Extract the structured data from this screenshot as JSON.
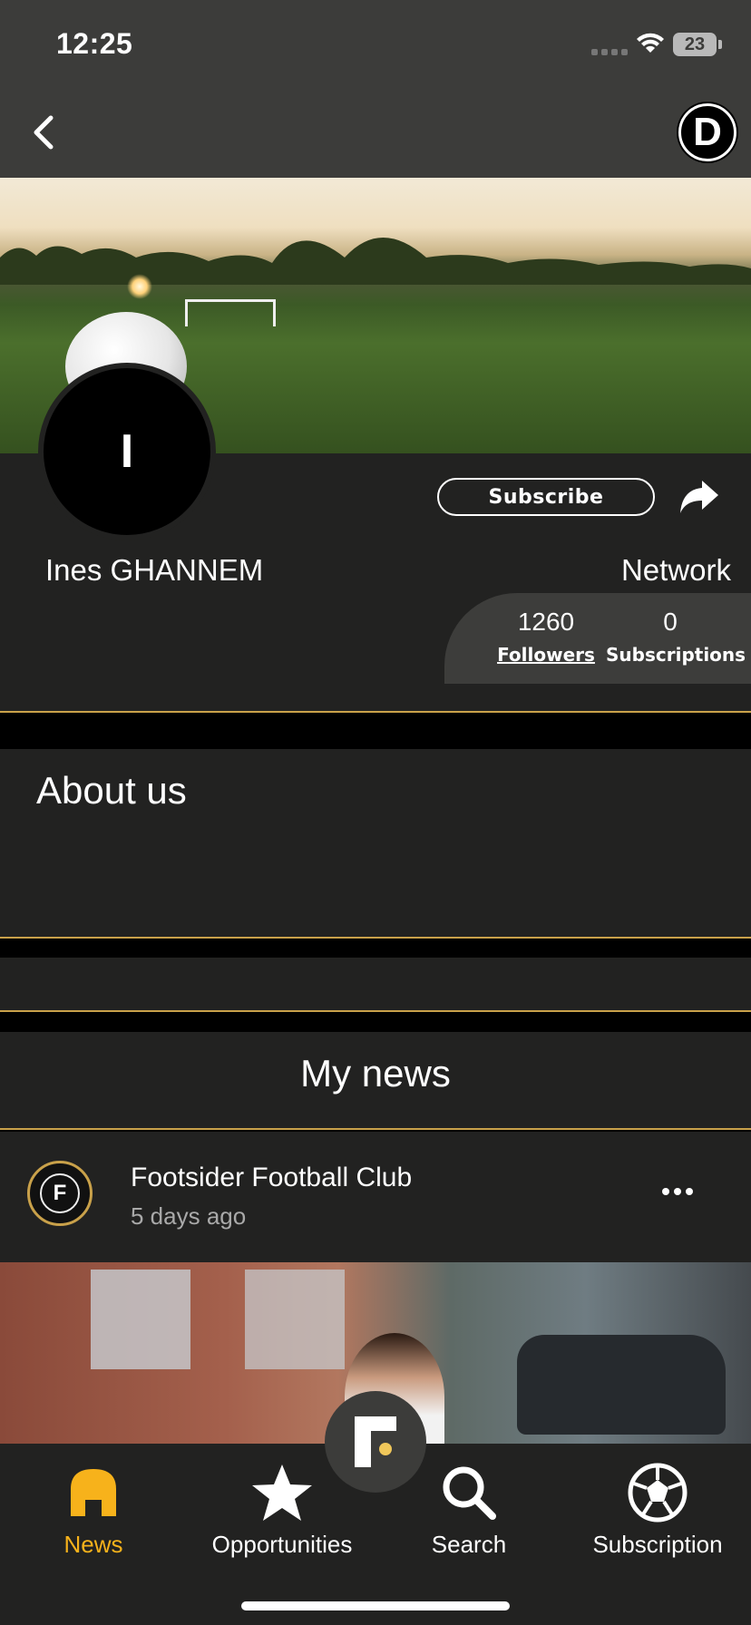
{
  "status_bar": {
    "time": "12:25",
    "battery": "23"
  },
  "header": {
    "logo_letter": "D"
  },
  "profile": {
    "avatar_letter": "I",
    "name": "Ines GHANNEM",
    "subscribe_label": "Subscribe",
    "network_label": "Network",
    "followers_count": "1260",
    "followers_label": "Followers",
    "subscriptions_count": "0",
    "subscriptions_label": "Subscriptions"
  },
  "about": {
    "title": "About us"
  },
  "news": {
    "title": "My news",
    "post": {
      "author": "Footsider Football Club",
      "time": "5 days ago",
      "logo_letter": "F"
    }
  },
  "bottom_nav": [
    {
      "label": "News",
      "icon": "home-icon",
      "active": true
    },
    {
      "label": "Opportunities",
      "icon": "star-icon",
      "active": false
    },
    {
      "label": "Search",
      "icon": "search-icon",
      "active": false
    },
    {
      "label": "Subscription",
      "icon": "soccer-ball-icon",
      "active": false
    }
  ],
  "colors": {
    "accent": "#f7b21b",
    "gold_line": "#c9a14a",
    "panel": "#222221",
    "header": "#3c3c3a"
  }
}
